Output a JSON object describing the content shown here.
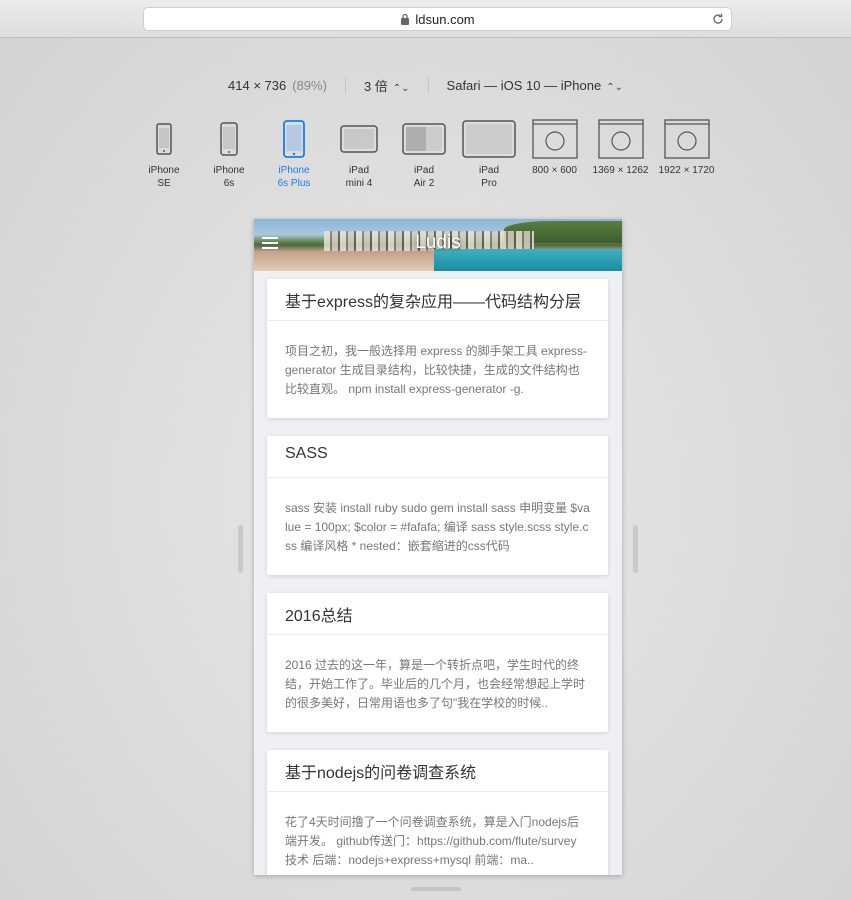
{
  "browser": {
    "url": "ldsun.com"
  },
  "toolbar": {
    "dimensions": "414 × 736",
    "zoom": "(89%)",
    "scale": "3 倍",
    "user_agent": "Safari — iOS 10 — iPhone"
  },
  "devices": [
    {
      "line1": "iPhone",
      "line2": "SE",
      "icon": "iphone-icon",
      "active": false
    },
    {
      "line1": "iPhone",
      "line2": "6s",
      "icon": "iphone-icon",
      "active": false
    },
    {
      "line1": "iPhone",
      "line2": "6s Plus",
      "icon": "iphone-icon",
      "active": true
    },
    {
      "line1": "iPad",
      "line2": "mini 4",
      "icon": "ipad-icon",
      "active": false
    },
    {
      "line1": "iPad",
      "line2": "Air 2",
      "icon": "ipad-split-icon",
      "active": false
    },
    {
      "line1": "iPad",
      "line2": "Pro",
      "icon": "ipad-icon",
      "active": false
    },
    {
      "line1": "800 × 600",
      "line2": "",
      "icon": "compass-window-icon",
      "active": false
    },
    {
      "line1": "1369 × 1262",
      "line2": "",
      "icon": "compass-window-icon",
      "active": false
    },
    {
      "line1": "1922 × 1720",
      "line2": "",
      "icon": "compass-window-icon",
      "active": false
    }
  ],
  "site": {
    "title": "Ludis"
  },
  "posts": [
    {
      "title": "基于express的复杂应用——代码结构分层",
      "excerpt": "项目之初，我一般选择用 express 的脚手架工具 express-generator 生成目录结构，比较快捷，生成的文件结构也比较直观。 npm install express-generator -g."
    },
    {
      "title": "SASS",
      "excerpt": "sass 安装 install ruby sudo gem install sass 申明变量 $value = 100px; $color = #fafafa; 编译 sass style.scss style.css 编译风格 * nested：嵌套缩进的css代码"
    },
    {
      "title": "2016总结",
      "excerpt": "2016 过去的这一年，算是一个转折点吧，学生时代的终结，开始工作了。毕业后的几个月，也会经常想起上学时的很多美好，日常用语也多了句\"我在学校的时候.."
    },
    {
      "title": "基于nodejs的问卷调查系统",
      "excerpt": "花了4天时间撸了一个问卷调查系统，算是入门nodejs后端开发。 github传送门：https://github.com/flute/survey 技术 后端：nodejs+express+mysql 前端：ma.."
    }
  ],
  "colors": {
    "accent": "#1a7cf0"
  }
}
